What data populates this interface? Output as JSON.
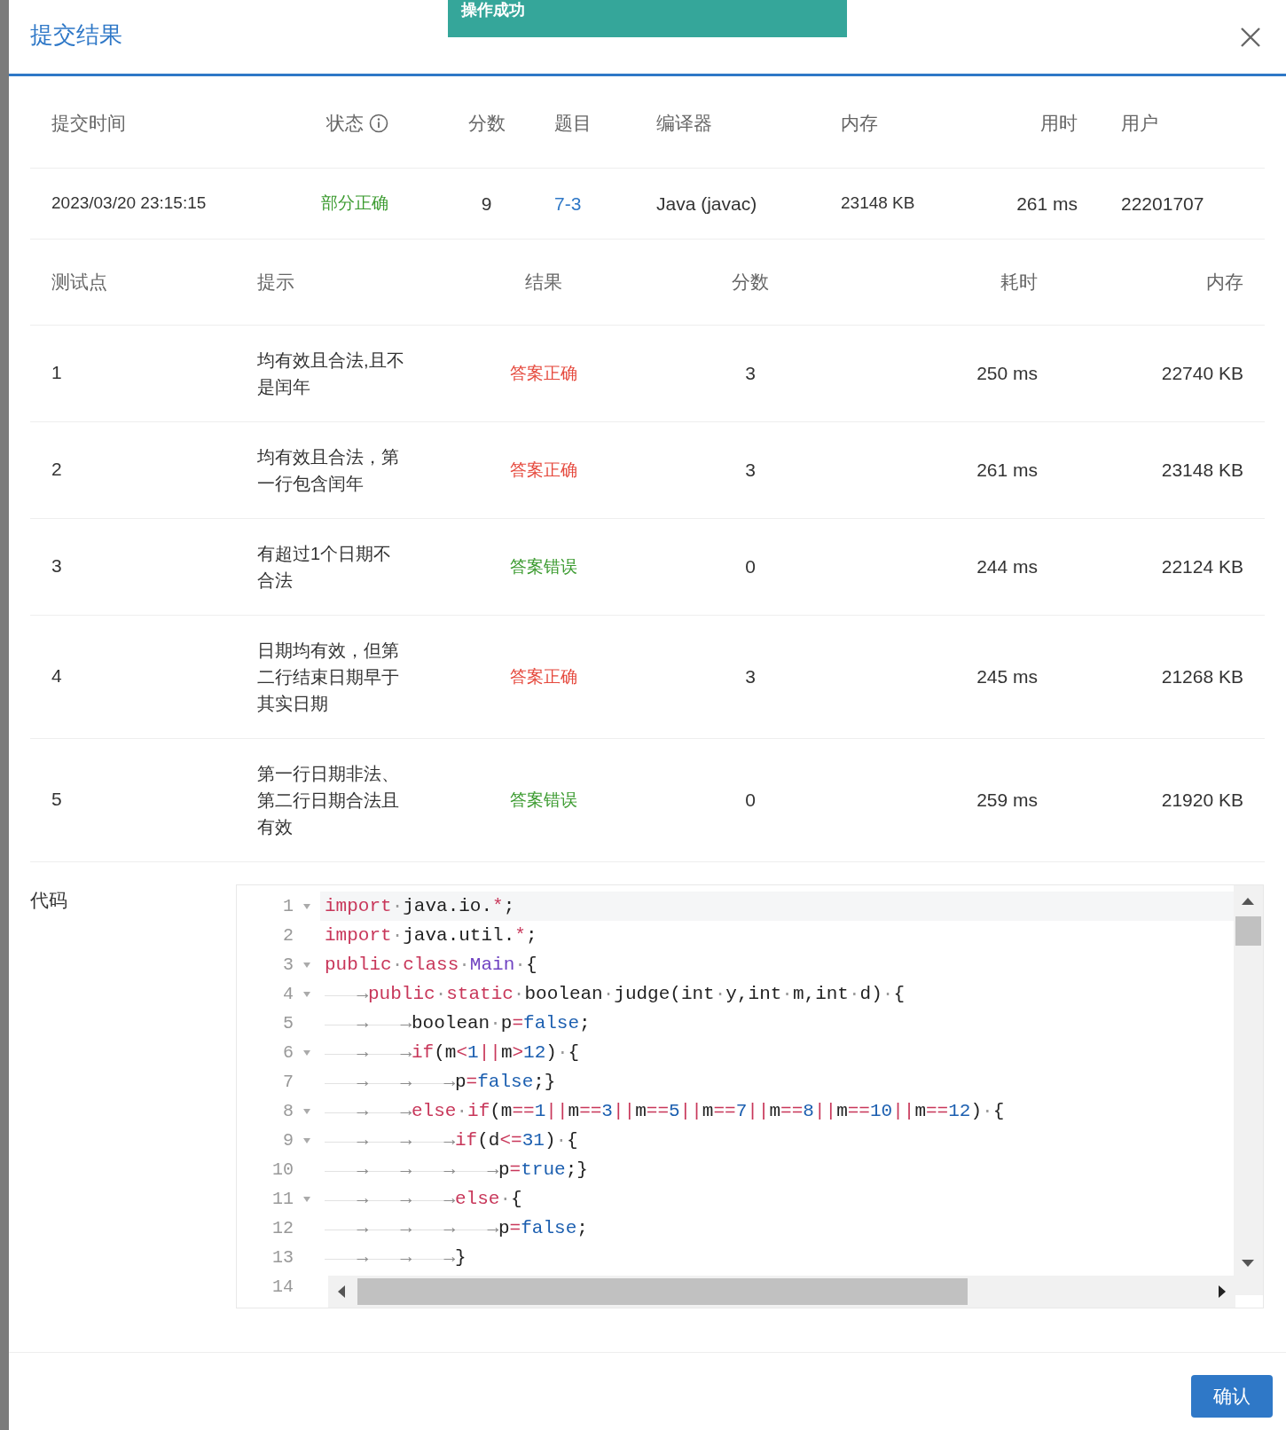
{
  "toast": {
    "text": "操作成功"
  },
  "dialog": {
    "title": "提交结果"
  },
  "submission": {
    "columns": [
      {
        "label": "提交时间"
      },
      {
        "label": "状态",
        "info": true
      },
      {
        "label": "分数"
      },
      {
        "label": "题目"
      },
      {
        "label": "编译器"
      },
      {
        "label": "内存"
      },
      {
        "label": "用时"
      },
      {
        "label": "用户"
      }
    ],
    "row": {
      "time": "2023/03/20 23:15:15",
      "status": {
        "text": "部分正确",
        "color": "#3a9a2e"
      },
      "score": "9",
      "problem": "7-3",
      "compiler": "Java (javac)",
      "memory": "23148 KB",
      "duration": "261 ms",
      "user": "22201707"
    }
  },
  "tests": {
    "columns": [
      "测试点",
      "提示",
      "结果",
      "分数",
      "耗时",
      "内存"
    ],
    "rows": [
      {
        "case": "1",
        "hint": "均有效且合法,且不是闰年",
        "result": "答案正确",
        "color": "#e5483c",
        "score": "3",
        "time": "250 ms",
        "memory": "22740 KB"
      },
      {
        "case": "2",
        "hint": "均有效且合法，第一行包含闰年",
        "result": "答案正确",
        "color": "#e5483c",
        "score": "3",
        "time": "261 ms",
        "memory": "23148 KB"
      },
      {
        "case": "3",
        "hint": "有超过1个日期不合法",
        "result": "答案错误",
        "color": "#3a9a2e",
        "score": "0",
        "time": "244 ms",
        "memory": "22124 KB"
      },
      {
        "case": "4",
        "hint": "日期均有效，但第二行结束日期早于其实日期",
        "result": "答案正确",
        "color": "#e5483c",
        "score": "3",
        "time": "245 ms",
        "memory": "21268 KB"
      },
      {
        "case": "5",
        "hint": "第一行日期非法、第二行日期合法且有效",
        "result": "答案错误",
        "color": "#3a9a2e",
        "score": "0",
        "time": "259 ms",
        "memory": "21920 KB"
      }
    ]
  },
  "code": {
    "label": "代码",
    "lines": [
      {
        "number": "1",
        "fold": true,
        "active": true,
        "tokens": [
          {
            "kind": "kw",
            "text": "import"
          },
          {
            "kind": "ws",
            "text": "·"
          },
          {
            "kind": "plain",
            "text": "java.io."
          },
          {
            "kind": "kw",
            "text": "*"
          },
          {
            "kind": "plain",
            "text": ";"
          }
        ]
      },
      {
        "number": "2",
        "fold": false,
        "active": false,
        "tokens": [
          {
            "kind": "kw",
            "text": "import"
          },
          {
            "kind": "ws",
            "text": "·"
          },
          {
            "kind": "plain",
            "text": "java.util."
          },
          {
            "kind": "kw",
            "text": "*"
          },
          {
            "kind": "plain",
            "text": ";"
          }
        ]
      },
      {
        "number": "3",
        "fold": true,
        "active": false,
        "tokens": [
          {
            "kind": "kw",
            "text": "public"
          },
          {
            "kind": "ws",
            "text": "·"
          },
          {
            "kind": "kw",
            "text": "class"
          },
          {
            "kind": "ws",
            "text": "·"
          },
          {
            "kind": "type",
            "text": "Main"
          },
          {
            "kind": "ws",
            "text": "·"
          },
          {
            "kind": "plain",
            "text": "{"
          }
        ]
      },
      {
        "number": "4",
        "fold": true,
        "active": false,
        "tokens": [
          {
            "kind": "tab",
            "text": "→"
          },
          {
            "kind": "kw",
            "text": "public"
          },
          {
            "kind": "ws",
            "text": "·"
          },
          {
            "kind": "kw",
            "text": "static"
          },
          {
            "kind": "ws",
            "text": "·"
          },
          {
            "kind": "plain",
            "text": "boolean"
          },
          {
            "kind": "ws",
            "text": "·"
          },
          {
            "kind": "plain",
            "text": "judge(int"
          },
          {
            "kind": "ws",
            "text": "·"
          },
          {
            "kind": "plain",
            "text": "y,int"
          },
          {
            "kind": "ws",
            "text": "·"
          },
          {
            "kind": "plain",
            "text": "m,int"
          },
          {
            "kind": "ws",
            "text": "·"
          },
          {
            "kind": "plain",
            "text": "d)"
          },
          {
            "kind": "ws",
            "text": "·"
          },
          {
            "kind": "plain",
            "text": "{"
          }
        ]
      },
      {
        "number": "5",
        "fold": false,
        "active": false,
        "tokens": [
          {
            "kind": "tab",
            "text": "→"
          },
          {
            "kind": "tab",
            "text": "→"
          },
          {
            "kind": "plain",
            "text": "boolean"
          },
          {
            "kind": "ws",
            "text": "·"
          },
          {
            "kind": "plain",
            "text": "p"
          },
          {
            "kind": "kw",
            "text": "="
          },
          {
            "kind": "lit",
            "text": "false"
          },
          {
            "kind": "plain",
            "text": ";"
          }
        ]
      },
      {
        "number": "6",
        "fold": true,
        "active": false,
        "tokens": [
          {
            "kind": "tab",
            "text": "→"
          },
          {
            "kind": "tab",
            "text": "→"
          },
          {
            "kind": "kw",
            "text": "if"
          },
          {
            "kind": "plain",
            "text": "(m"
          },
          {
            "kind": "kw",
            "text": "<"
          },
          {
            "kind": "lit",
            "text": "1"
          },
          {
            "kind": "kw",
            "text": "||"
          },
          {
            "kind": "plain",
            "text": "m"
          },
          {
            "kind": "kw",
            "text": ">"
          },
          {
            "kind": "lit",
            "text": "12"
          },
          {
            "kind": "plain",
            "text": ")"
          },
          {
            "kind": "ws",
            "text": "·"
          },
          {
            "kind": "plain",
            "text": "{"
          }
        ]
      },
      {
        "number": "7",
        "fold": false,
        "active": false,
        "tokens": [
          {
            "kind": "tab",
            "text": "→"
          },
          {
            "kind": "tab",
            "text": "→"
          },
          {
            "kind": "tab",
            "text": "→"
          },
          {
            "kind": "plain",
            "text": "p"
          },
          {
            "kind": "kw",
            "text": "="
          },
          {
            "kind": "lit",
            "text": "false"
          },
          {
            "kind": "plain",
            "text": ";}"
          }
        ]
      },
      {
        "number": "8",
        "fold": true,
        "active": false,
        "tokens": [
          {
            "kind": "tab",
            "text": "→"
          },
          {
            "kind": "tab",
            "text": "→"
          },
          {
            "kind": "kw",
            "text": "else"
          },
          {
            "kind": "ws",
            "text": "·"
          },
          {
            "kind": "kw",
            "text": "if"
          },
          {
            "kind": "plain",
            "text": "(m"
          },
          {
            "kind": "kw",
            "text": "=="
          },
          {
            "kind": "lit",
            "text": "1"
          },
          {
            "kind": "kw",
            "text": "||"
          },
          {
            "kind": "plain",
            "text": "m"
          },
          {
            "kind": "kw",
            "text": "=="
          },
          {
            "kind": "lit",
            "text": "3"
          },
          {
            "kind": "kw",
            "text": "||"
          },
          {
            "kind": "plain",
            "text": "m"
          },
          {
            "kind": "kw",
            "text": "=="
          },
          {
            "kind": "lit",
            "text": "5"
          },
          {
            "kind": "kw",
            "text": "||"
          },
          {
            "kind": "plain",
            "text": "m"
          },
          {
            "kind": "kw",
            "text": "=="
          },
          {
            "kind": "lit",
            "text": "7"
          },
          {
            "kind": "kw",
            "text": "||"
          },
          {
            "kind": "plain",
            "text": "m"
          },
          {
            "kind": "kw",
            "text": "=="
          },
          {
            "kind": "lit",
            "text": "8"
          },
          {
            "kind": "kw",
            "text": "||"
          },
          {
            "kind": "plain",
            "text": "m"
          },
          {
            "kind": "kw",
            "text": "=="
          },
          {
            "kind": "lit",
            "text": "10"
          },
          {
            "kind": "kw",
            "text": "||"
          },
          {
            "kind": "plain",
            "text": "m"
          },
          {
            "kind": "kw",
            "text": "=="
          },
          {
            "kind": "lit",
            "text": "12"
          },
          {
            "kind": "plain",
            "text": ")"
          },
          {
            "kind": "ws",
            "text": "·"
          },
          {
            "kind": "plain",
            "text": "{"
          }
        ]
      },
      {
        "number": "9",
        "fold": true,
        "active": false,
        "tokens": [
          {
            "kind": "tab",
            "text": "→"
          },
          {
            "kind": "tab",
            "text": "→"
          },
          {
            "kind": "tab",
            "text": "→"
          },
          {
            "kind": "kw",
            "text": "if"
          },
          {
            "kind": "plain",
            "text": "(d"
          },
          {
            "kind": "kw",
            "text": "<="
          },
          {
            "kind": "lit",
            "text": "31"
          },
          {
            "kind": "plain",
            "text": ")"
          },
          {
            "kind": "ws",
            "text": "·"
          },
          {
            "kind": "plain",
            "text": "{"
          }
        ]
      },
      {
        "number": "10",
        "fold": false,
        "active": false,
        "tokens": [
          {
            "kind": "tab",
            "text": "→"
          },
          {
            "kind": "tab",
            "text": "→"
          },
          {
            "kind": "tab",
            "text": "→"
          },
          {
            "kind": "tab",
            "text": "→"
          },
          {
            "kind": "plain",
            "text": "p"
          },
          {
            "kind": "kw",
            "text": "="
          },
          {
            "kind": "lit",
            "text": "true"
          },
          {
            "kind": "plain",
            "text": ";}"
          }
        ]
      },
      {
        "number": "11",
        "fold": true,
        "active": false,
        "tokens": [
          {
            "kind": "tab",
            "text": "→"
          },
          {
            "kind": "tab",
            "text": "→"
          },
          {
            "kind": "tab",
            "text": "→"
          },
          {
            "kind": "kw",
            "text": "else"
          },
          {
            "kind": "ws",
            "text": "·"
          },
          {
            "kind": "plain",
            "text": "{"
          }
        ]
      },
      {
        "number": "12",
        "fold": false,
        "active": false,
        "tokens": [
          {
            "kind": "tab",
            "text": "→"
          },
          {
            "kind": "tab",
            "text": "→"
          },
          {
            "kind": "tab",
            "text": "→"
          },
          {
            "kind": "tab",
            "text": "→"
          },
          {
            "kind": "plain",
            "text": "p"
          },
          {
            "kind": "kw",
            "text": "="
          },
          {
            "kind": "lit",
            "text": "false"
          },
          {
            "kind": "plain",
            "text": ";"
          }
        ]
      },
      {
        "number": "13",
        "fold": false,
        "active": false,
        "tokens": [
          {
            "kind": "tab",
            "text": "→"
          },
          {
            "kind": "tab",
            "text": "→"
          },
          {
            "kind": "tab",
            "text": "→"
          },
          {
            "kind": "plain",
            "text": "}"
          }
        ]
      },
      {
        "number": "14",
        "fold": false,
        "active": false
      }
    ]
  },
  "footer": {
    "confirm": "确认"
  }
}
